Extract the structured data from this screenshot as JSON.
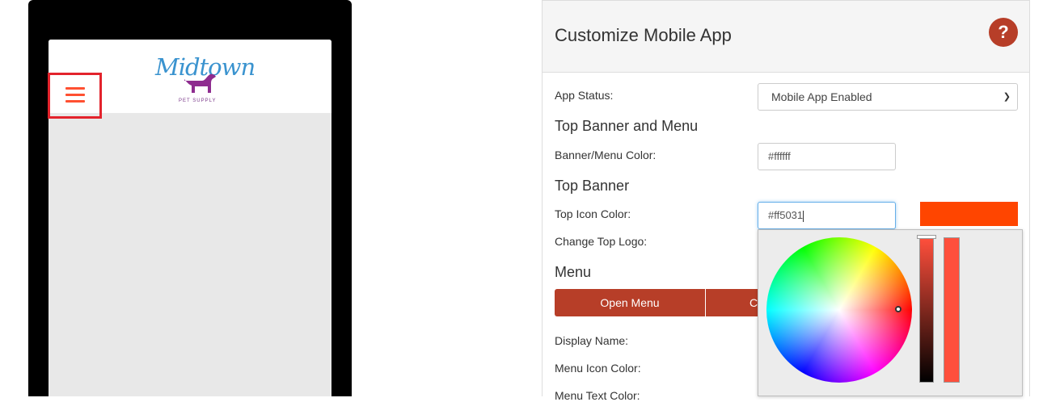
{
  "preview": {
    "logo_text": "Midtown",
    "logo_sub": "PET SUPPLY"
  },
  "panel": {
    "title": "Customize Mobile App",
    "help_label": "?"
  },
  "form": {
    "app_status_label": "App Status:",
    "app_status_value": "Mobile App Enabled",
    "section_top_banner_menu": "Top Banner and Menu",
    "banner_menu_color_label": "Banner/Menu Color:",
    "banner_menu_color_value": "#ffffff",
    "section_top_banner": "Top Banner",
    "top_icon_color_label": "Top Icon Color:",
    "top_icon_color_value": "#ff5031",
    "top_icon_swatch_color": "#ff4500",
    "change_top_logo_label": "Change Top Logo:",
    "section_menu": "Menu",
    "open_menu_label": "Open Menu",
    "close_menu_label": "C",
    "display_name_label": "Display Name:",
    "menu_icon_color_label": "Menu Icon Color:",
    "menu_text_color_label": "Menu Text Color:"
  },
  "colors": {
    "accent": "#b73e28",
    "icon_color": "#ff5031",
    "highlight": "#e3232c"
  }
}
